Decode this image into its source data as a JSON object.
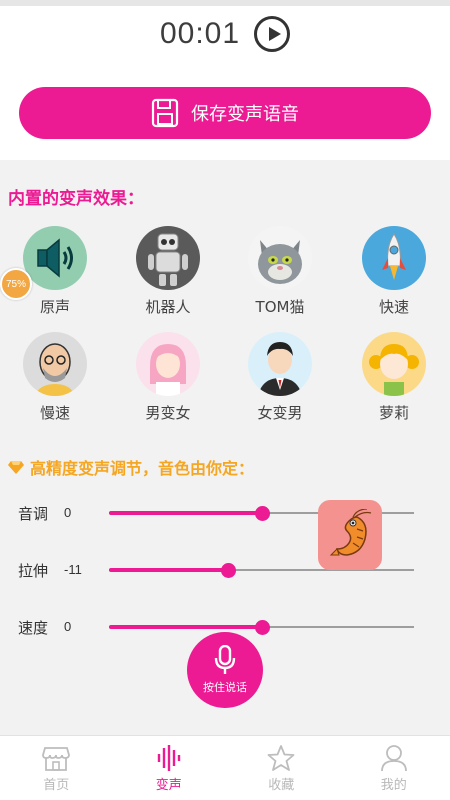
{
  "timer": {
    "time": "00:01"
  },
  "save_button": {
    "label": "保存变声语音"
  },
  "effects": {
    "title": "内置的变声效果：",
    "badge": "75%",
    "items": [
      {
        "label": "原声",
        "icon": "speaker-icon"
      },
      {
        "label": "机器人",
        "icon": "robot-icon"
      },
      {
        "label": "TOM猫",
        "icon": "tom-cat-icon"
      },
      {
        "label": "快速",
        "icon": "rocket-icon"
      },
      {
        "label": "慢速",
        "icon": "old-man-icon"
      },
      {
        "label": "男变女",
        "icon": "girl-icon"
      },
      {
        "label": "女变男",
        "icon": "man-icon"
      },
      {
        "label": "萝莉",
        "icon": "little-girl-icon"
      }
    ]
  },
  "tuning": {
    "title": "高精度变声调节，音色由你定：",
    "sliders": [
      {
        "label": "音调",
        "value": "0",
        "fill_fraction": 0.5
      },
      {
        "label": "拉伸",
        "value": "-11",
        "fill_fraction": 0.39
      },
      {
        "label": "速度",
        "value": "0",
        "fill_fraction": 0.5
      }
    ]
  },
  "talk_button": {
    "label": "按住说话"
  },
  "tabbar": {
    "tabs": [
      {
        "label": "首页",
        "icon": "shop-icon",
        "active": false
      },
      {
        "label": "变声",
        "icon": "waveform-icon",
        "active": true
      },
      {
        "label": "收藏",
        "icon": "star-icon",
        "active": false
      },
      {
        "label": "我的",
        "icon": "user-icon",
        "active": false
      }
    ]
  },
  "colors": {
    "accent": "#ec1b93",
    "gold": "#f5a623",
    "panel": "#f2f2f2"
  }
}
